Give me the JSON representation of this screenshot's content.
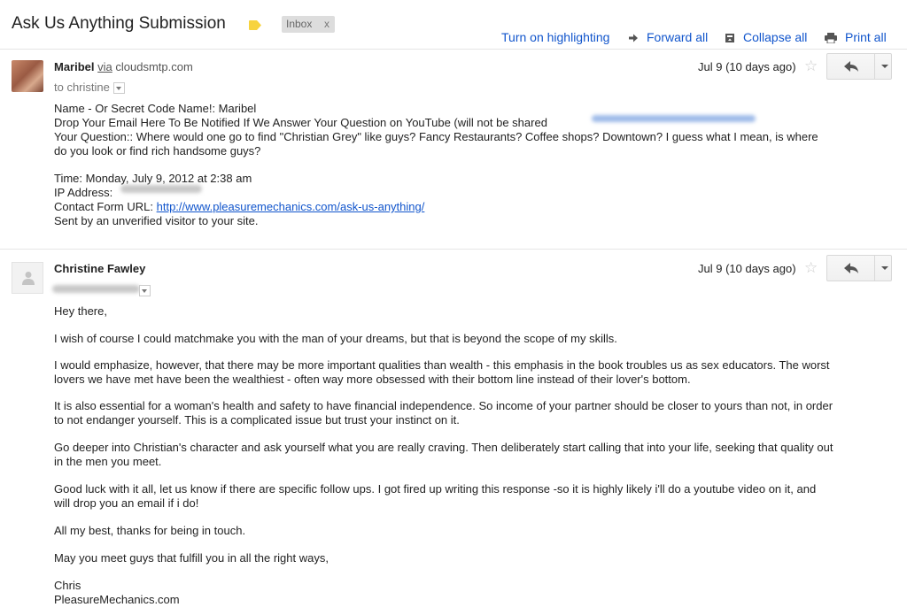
{
  "thread": {
    "subject": "Ask Us Anything Submission",
    "label": "Inbox",
    "label_remove": "x",
    "label_color": "#f7d33e"
  },
  "toolbar": {
    "highlighting": "Turn on highlighting",
    "forward_all": "Forward all",
    "collapse_all": "Collapse all",
    "print_all": "Print all"
  },
  "message1": {
    "sender_name": "Maribel",
    "via_word": "via",
    "via_domain": "cloudsmtp.com",
    "to": "to christine",
    "date": "Jul 9 (10 days ago)",
    "lines": [
      "Name - Or Secret Code Name!: Maribel",
      "Drop Your Email Here To Be Notified If We Answer Your Question on YouTube (will not be shared",
      "Your Question:: Where would one go to find \"Christian Grey\" like guys? Fancy Restaurants? Coffee shops? Downtown? I guess what I mean, is where",
      "do you look or find rich handsome guys?",
      "Time: Monday, July 9, 2012 at 2:38 am",
      "IP Address:",
      "Contact Form URL:",
      "Sent by an unverified visitor to your site."
    ],
    "url": "http://www.pleasuremechanics.com/ask-us-anything/"
  },
  "message2": {
    "sender_name": "Christine Fawley",
    "date": "Jul 9 (10 days ago)",
    "lines": [
      "Hey there,",
      "I wish of course I could matchmake you with the man of your dreams, but that is beyond the scope of my skills.",
      "I would emphasize, however, that there may be more important qualities than wealth - this emphasis in the book troubles us as sex educators. The worst",
      "lovers we have met have been the wealthiest - often way more obsessed with their bottom line instead of their lover's bottom.",
      "It is also essential for a woman's health and safety to have financial independence. So income of your partner should be closer to yours than not, in order",
      "to not endanger yourself. This is a complicated issue but trust your instinct on it.",
      "Go deeper into Christian's character and ask yourself what you are really craving. Then deliberately start calling that into your life, seeking that quality out",
      "in the men you meet.",
      "Good luck with it all, let us know if there are specific follow ups. I got fired up writing this response -so it is highly likely i'll do a youtube video on it, and",
      "will drop you an email if i do!",
      "All my best, thanks for being in touch.",
      "May you meet guys that fulfill you in all the right ways,",
      "Chris",
      "PleasureMechanics.com"
    ]
  }
}
